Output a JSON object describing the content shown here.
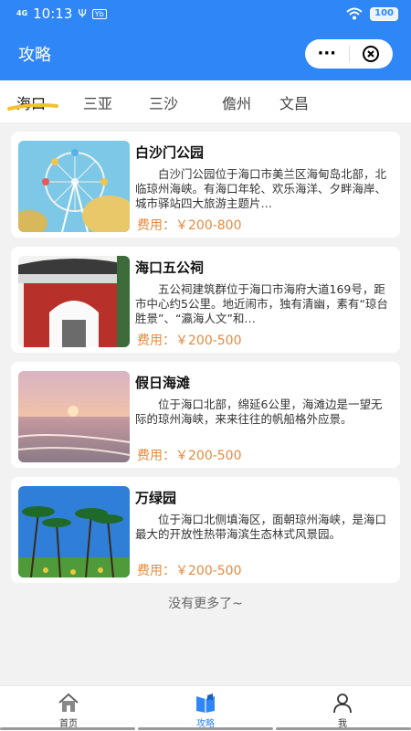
{
  "status_bar": {
    "network": "4G",
    "time": "10:13",
    "usb": "Ψ",
    "badge": "Yb",
    "battery": "100"
  },
  "header": {
    "title": "攻略",
    "more_label": "···"
  },
  "tabs": [
    "海口",
    "三亚",
    "三沙",
    "儋州",
    "文昌"
  ],
  "spots": [
    {
      "name": "白沙门公园",
      "desc": "白沙门公园位于海口市美兰区海甸岛北部，北临琼州海峡。有海口年轮、欢乐海洋、夕畔海岸、城市驿站四大旅游主题片…",
      "price": "费用：￥200-800"
    },
    {
      "name": "海口五公祠",
      "desc": "五公祠建筑群位于海口市海府大道169号，距市中心约5公里。地近闹市，独有清幽，素有“琼台胜景”、“瀛海人文”和…",
      "price": "费用：￥200-500"
    },
    {
      "name": "假日海滩",
      "desc": "位于海口北部，绵延6公里，海滩边是一望无际的琼州海峡，来来往往的帆船格外应景。",
      "price": "费用：￥200-500"
    },
    {
      "name": "万绿园",
      "desc": "位于海口北侧填海区，面朝琼州海峡，是海口最大的开放性热带海滨生态林式风景园。",
      "price": "费用：￥200-500"
    }
  ],
  "end_text": "没有更多了~",
  "tabbar": [
    {
      "label": "首页",
      "icon": "home-icon"
    },
    {
      "label": "攻略",
      "icon": "book-icon"
    },
    {
      "label": "我",
      "icon": "user-icon"
    }
  ],
  "colors": {
    "primary": "#2f86f6",
    "price": "#e68a3c",
    "tab_underline": "#f2c230"
  }
}
